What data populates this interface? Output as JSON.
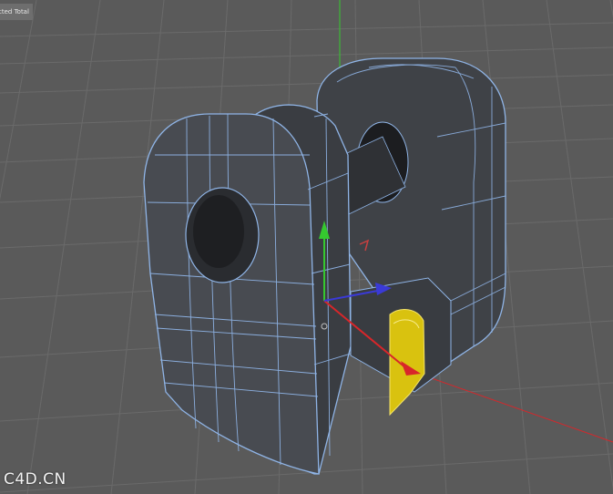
{
  "hud": {
    "stats_label": "cted Total"
  },
  "watermark": {
    "text": "C4D.CN"
  },
  "colors": {
    "background": "#5a5a5a",
    "grid": "#6c6c6c",
    "model_fill": "#3f4247",
    "wire": "#8fb4e6",
    "selected_face": "#d9c20f",
    "axis_y": "#35c92f",
    "axis_x": "#d8262a",
    "axis_z": "#3a3ad6"
  },
  "viewport": {
    "object": "bracket-mesh",
    "selection": "polygon-face",
    "tool": "move-gizmo"
  }
}
